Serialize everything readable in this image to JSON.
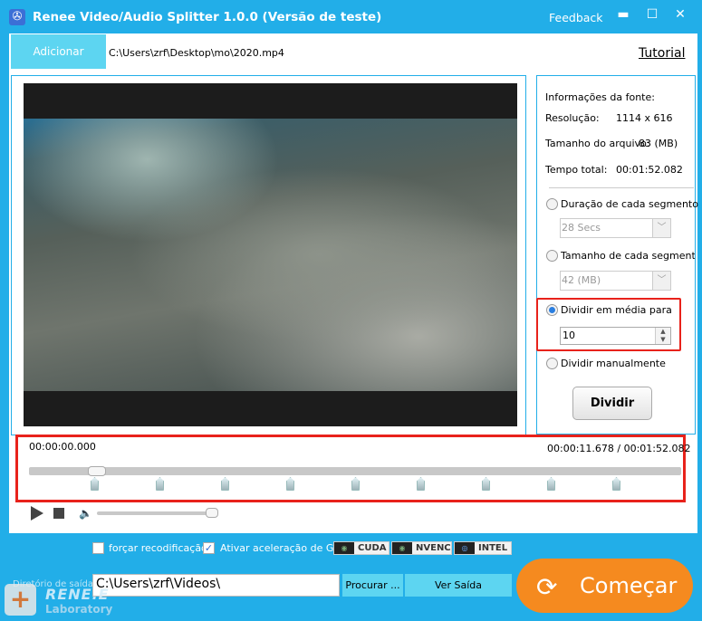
{
  "titlebar": {
    "title": "Renee Video/Audio Splitter 1.0.0 (Versão de teste)",
    "feedback": "Feedback",
    "minimize": "▬",
    "maximize": "☐",
    "close": "✕"
  },
  "toolbar": {
    "add_file": "Adicionar Arquivo",
    "file_path": "C:\\Users\\zrf\\Desktop\\mo\\2020.mp4",
    "tutorial": "Tutorial"
  },
  "info": {
    "heading": "Informações da fonte:",
    "resolution_label": "Resolução:",
    "resolution": "1114 x 616",
    "size_label": "Tamanho do arquivo:",
    "size": "83 (MB)",
    "duration_label": "Tempo total:",
    "duration": "00:01:52.082"
  },
  "options": {
    "by_duration": {
      "label": "Duração de cada segmento",
      "value": "28 Secs",
      "selected": false
    },
    "by_size": {
      "label": "Tamanho de cada segmento",
      "value": "42 (MB)",
      "selected": false
    },
    "average": {
      "label": "Dividir em média para",
      "value": "10",
      "selected": true
    },
    "manual": {
      "label": "Dividir manualmente",
      "selected": false
    },
    "divide_button": "Dividir"
  },
  "timeline": {
    "start": "00:00:00.000",
    "current": "00:00:11.678 / 00:01:52.082",
    "progress": 0.104,
    "split_markers": 9,
    "volume": 0.95
  },
  "encoding": {
    "force_reencode": {
      "label": "forçar recodificação",
      "checked": false
    },
    "gpu": {
      "label": "Ativar aceleração de GPU",
      "checked": true
    },
    "gpu_options": [
      "CUDA",
      "NVENC",
      "INTEL"
    ]
  },
  "output": {
    "label": "Diretório de saída:",
    "path": "C:\\Users\\zrf\\Videos\\",
    "browse": "Procurar ...",
    "view": "Ver Saída",
    "start": "Começar"
  },
  "brand": {
    "name": "RENE.E",
    "sub": "Laboratory"
  },
  "colors": {
    "accent": "#22aee8",
    "button": "#5dd5f1",
    "highlight": "#e8221b",
    "start": "#f58a1f"
  }
}
